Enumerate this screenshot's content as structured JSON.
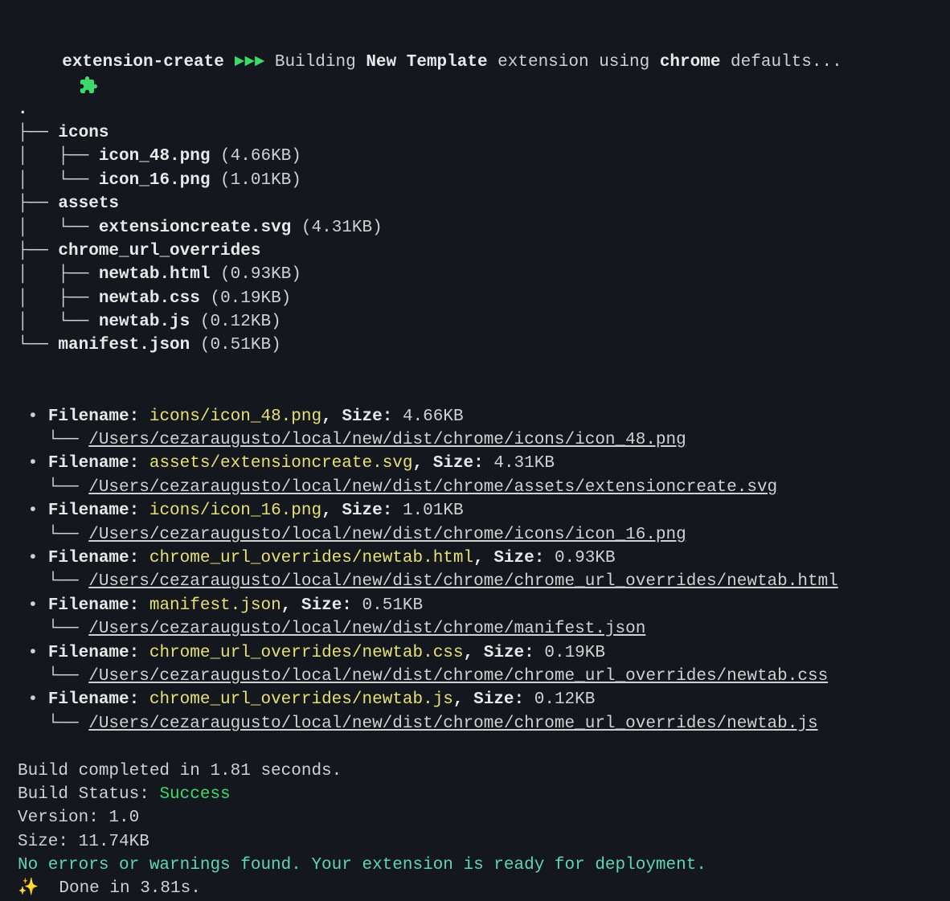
{
  "header": {
    "tool": "extension-create",
    "arrows": "►►►",
    "action": "Building",
    "project": "New Template",
    "middle": "extension using",
    "browser": "chrome",
    "suffix": "defaults..."
  },
  "tree": {
    "root": ".",
    "nodes": [
      {
        "prefix": "├── ",
        "name": "icons",
        "size": ""
      },
      {
        "prefix": "│   ├── ",
        "name": "icon_48.png",
        "size": "(4.66KB)"
      },
      {
        "prefix": "│   └── ",
        "name": "icon_16.png",
        "size": "(1.01KB)"
      },
      {
        "prefix": "├── ",
        "name": "assets",
        "size": ""
      },
      {
        "prefix": "│   └── ",
        "name": "extensioncreate.svg",
        "size": "(4.31KB)"
      },
      {
        "prefix": "├── ",
        "name": "chrome_url_overrides",
        "size": ""
      },
      {
        "prefix": "│   ├── ",
        "name": "newtab.html",
        "size": "(0.93KB)"
      },
      {
        "prefix": "│   ├── ",
        "name": "newtab.css",
        "size": "(0.19KB)"
      },
      {
        "prefix": "│   └── ",
        "name": "newtab.js",
        "size": "(0.12KB)"
      },
      {
        "prefix": "└── ",
        "name": "manifest.json",
        "size": "(0.51KB)"
      }
    ]
  },
  "files": [
    {
      "name": "icons/icon_48.png",
      "size": "4.66KB",
      "path": "/Users/cezaraugusto/local/new/dist/chrome/icons/icon_48.png"
    },
    {
      "name": "assets/extensioncreate.svg",
      "size": "4.31KB",
      "path": "/Users/cezaraugusto/local/new/dist/chrome/assets/extensioncreate.svg"
    },
    {
      "name": "icons/icon_16.png",
      "size": "1.01KB",
      "path": "/Users/cezaraugusto/local/new/dist/chrome/icons/icon_16.png"
    },
    {
      "name": "chrome_url_overrides/newtab.html",
      "size": "0.93KB",
      "path": "/Users/cezaraugusto/local/new/dist/chrome/chrome_url_overrides/newtab.html"
    },
    {
      "name": "manifest.json",
      "size": "0.51KB",
      "path": "/Users/cezaraugusto/local/new/dist/chrome/manifest.json"
    },
    {
      "name": "chrome_url_overrides/newtab.css",
      "size": "0.19KB",
      "path": "/Users/cezaraugusto/local/new/dist/chrome/chrome_url_overrides/newtab.css"
    },
    {
      "name": "chrome_url_overrides/newtab.js",
      "size": "0.12KB",
      "path": "/Users/cezaraugusto/local/new/dist/chrome/chrome_url_overrides/newtab.js"
    }
  ],
  "labels": {
    "filename": "Filename:",
    "size": "Size:",
    "treepath": "   └──"
  },
  "footer": {
    "build_time": "Build completed in 1.81 seconds.",
    "status_label": "Build Status: ",
    "status_value": "Success",
    "version": "Version: 1.0",
    "size": "Size: 11.74KB",
    "ready": "No errors or warnings found. Your extension is ready for deployment.",
    "done": "Done in 3.81s."
  }
}
